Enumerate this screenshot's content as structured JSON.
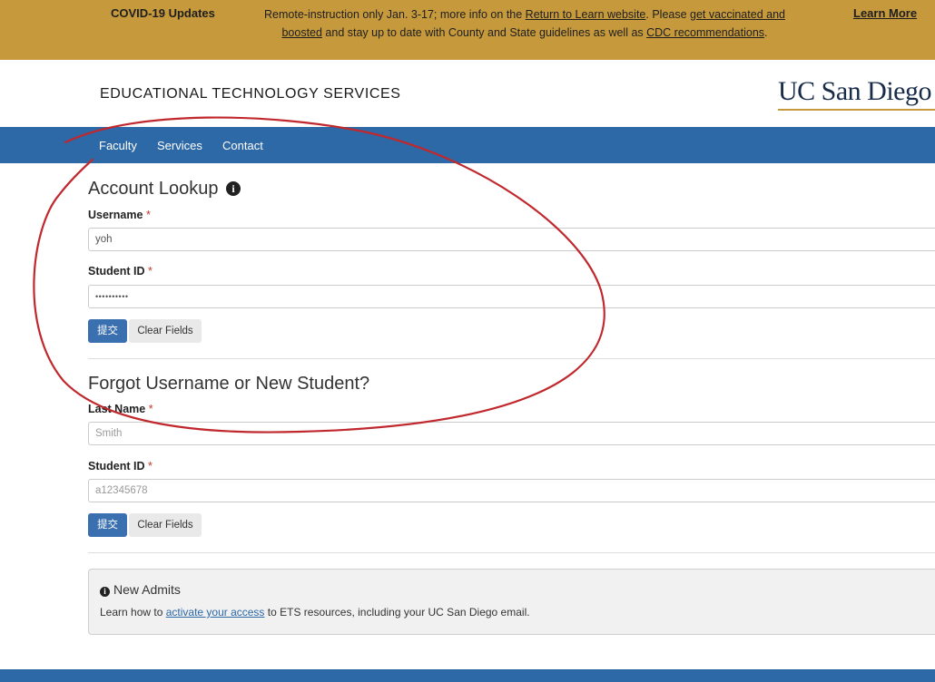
{
  "banner": {
    "title": "COVID-19 Updates",
    "msg_part1": "Remote-instruction only Jan. 3-17; more info on the ",
    "link_return": "Return to Learn website",
    "msg_part2": ". Please ",
    "link_vaccinated": "get vaccinated and boosted",
    "msg_part3": " and stay up to date with County and State guidelines as well as ",
    "link_cdc": "CDC recommendations",
    "msg_part4": ".",
    "learn_more": "Learn More",
    "color": "#c69a3c"
  },
  "header": {
    "site_title": "EDUCATIONAL TECHNOLOGY SERVICES",
    "logo": "UC San Diego"
  },
  "nav": {
    "color": "#2d68a7",
    "items": [
      {
        "label": "Faculty"
      },
      {
        "label": "Services"
      },
      {
        "label": "Contact"
      }
    ]
  },
  "account_lookup": {
    "heading": "Account Lookup",
    "info_icon": "info-circle-icon",
    "username_label": "Username",
    "username_value": "yoh",
    "student_id_label": "Student ID",
    "student_id_value": "••••••••••",
    "required_mark": "*",
    "submit_label": "提交",
    "clear_label": "Clear Fields"
  },
  "forgot": {
    "heading": "Forgot Username or New Student?",
    "last_name_label": "Last Name",
    "last_name_placeholder": "Smith",
    "student_id_label": "Student ID",
    "student_id_placeholder": "a12345678",
    "required_mark": "*",
    "submit_label": "提交",
    "clear_label": "Clear Fields"
  },
  "new_admits": {
    "title": "New Admits",
    "text_before": "Learn how to ",
    "link": "activate your access",
    "text_after": " to ETS resources, including your UC San Diego email."
  },
  "annotation": {
    "color": "#c0282d"
  }
}
